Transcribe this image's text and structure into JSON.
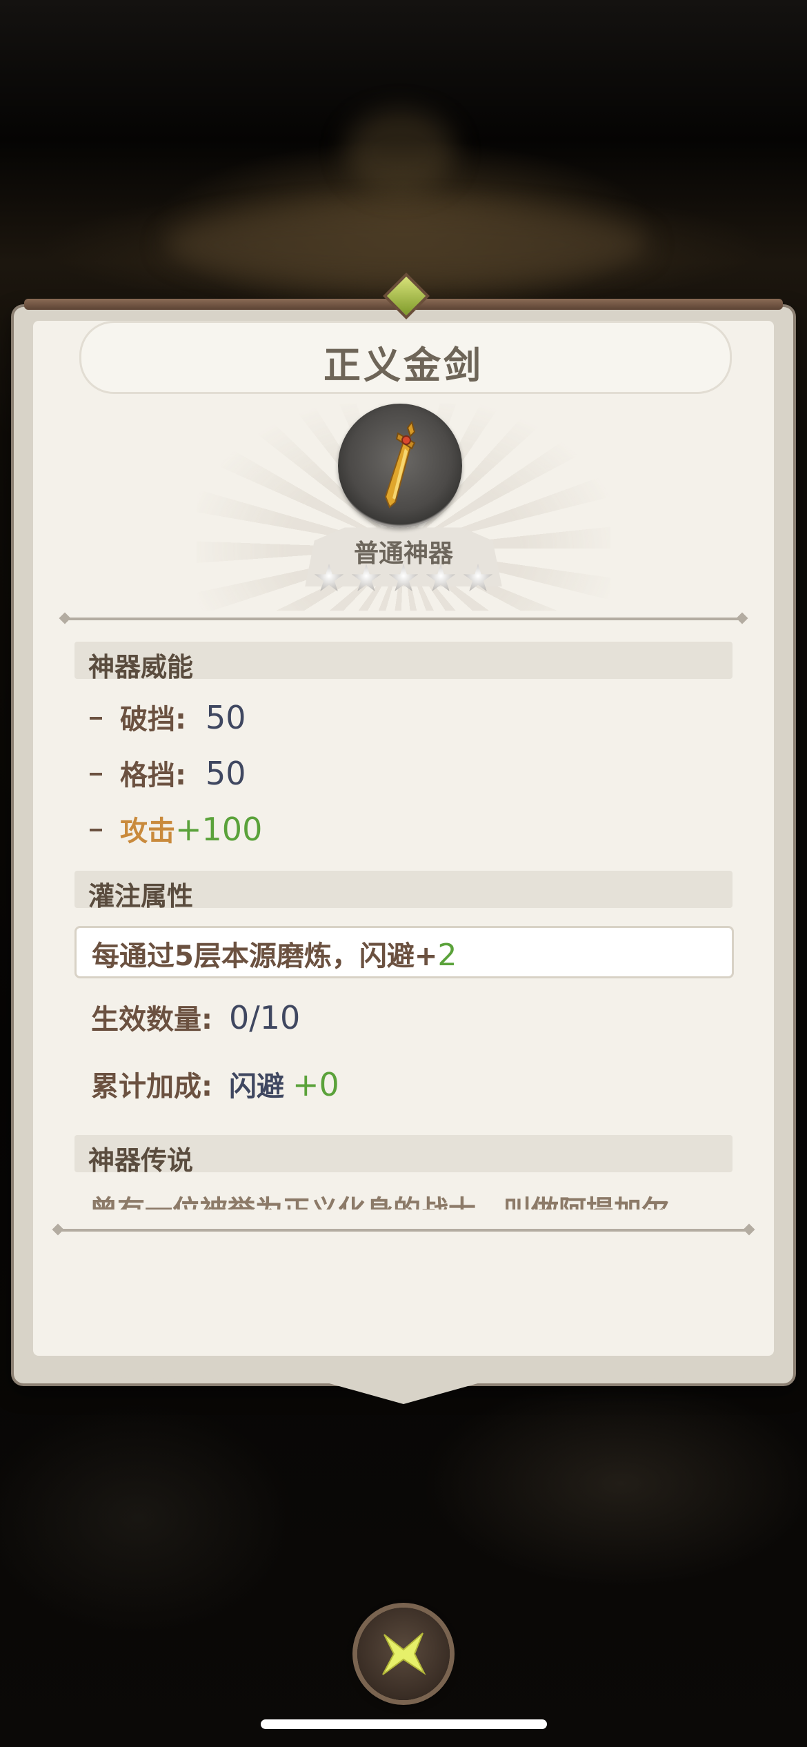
{
  "item": {
    "name": "正义金剑",
    "rarity": "普通神器",
    "stars": 5
  },
  "sections": {
    "power_title": "神器威能",
    "infuse_title": "灌注属性",
    "lore_title": "神器传说"
  },
  "power": {
    "break_label": "破挡:",
    "break_value": "50",
    "block_label": "格挡:",
    "block_value": "50",
    "attack_label": "攻击",
    "attack_value": "+100"
  },
  "infuse": {
    "effect_text": "每通过5层本源磨炼，闪避+",
    "effect_value": "2",
    "active_label": "生效数量:",
    "active_value": "0/10",
    "total_label": "累计加成:",
    "total_stat": "闪避",
    "total_value": "+0"
  },
  "lore": {
    "text": "曾有一位被誉为正义化身的战士，叫做阿提加尔"
  },
  "icons": {
    "close": "close-x-icon",
    "item": "golden-sword-icon",
    "gem": "gem-icon"
  },
  "colors": {
    "accent_green": "#5aa23a",
    "attack_orange": "#c98a3c",
    "value_blue": "#3f4760",
    "close_x": "#e6f06a"
  }
}
